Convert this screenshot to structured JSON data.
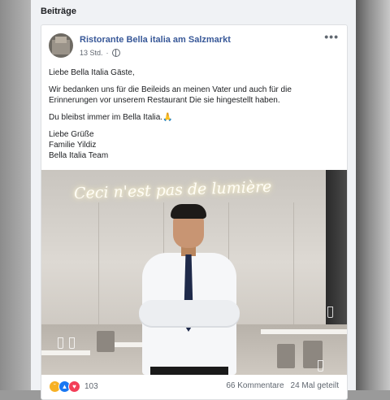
{
  "section": {
    "title": "Beiträge"
  },
  "post": {
    "page_name": "Ristorante Bella italia am Salzmarkt",
    "time": "13 Std.",
    "more_label": "•••",
    "paragraphs": [
      "Liebe Bella Italia Gäste,",
      "Wir bedanken uns für die Beileids an meinen Vater und auch für die Erinnerungen vor unserem Restaurant Die sie hingestellt haben.",
      "Du bleibst immer im Bella Italia.🙏"
    ],
    "signature": [
      "Liebe Grüße",
      "Familie Yildiz",
      "Bella Italia Team"
    ],
    "photo": {
      "neon_text": "Ceci n'est pas de lumière"
    },
    "reactions": {
      "icons": [
        "sad-reaction-icon",
        "like-reaction-icon",
        "love-reaction-icon"
      ],
      "count": "103"
    },
    "comments": "66 Kommentare",
    "shares": "24 Mal geteilt"
  },
  "colors": {
    "link": "#385898",
    "like": "#1877f2",
    "love": "#f33e58",
    "sad": "#f7b125"
  }
}
